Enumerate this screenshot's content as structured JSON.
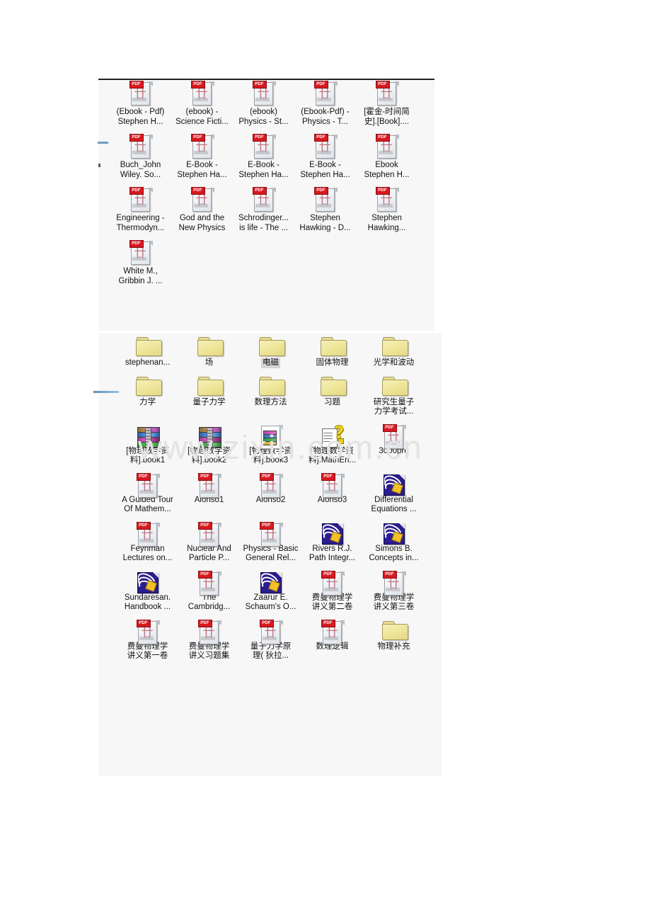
{
  "page": {
    "watermark": "www.zixin.com.cn",
    "background": "#ffffff",
    "panel_bg": "#f7f7f7",
    "selection_bg": "#d4d4d4"
  },
  "panels": [
    {
      "name": "files-panel",
      "kind": "file-list"
    },
    {
      "name": "folders-panel",
      "kind": "folder-and-file-list"
    }
  ],
  "files_panel": {
    "items": [
      {
        "icon": "pdf-icon",
        "label": "(Ebook - Pdf)\nStephen H...",
        "selected": false
      },
      {
        "icon": "pdf-icon",
        "label": "(ebook) -\nScience Ficti...",
        "selected": false
      },
      {
        "icon": "pdf-icon",
        "label": "(ebook)\nPhysics - St...",
        "selected": false
      },
      {
        "icon": "pdf-icon",
        "label": "(Ebook-Pdf) -\nPhysics - T...",
        "selected": false
      },
      {
        "icon": "pdf-icon",
        "label": "[霍金-时间简\n史].[Book]....",
        "selected": false
      },
      {
        "icon": "pdf-icon",
        "label": "Buch_John\nWiley. So...",
        "selected": false
      },
      {
        "icon": "pdf-icon",
        "label": "E-Book -\nStephen Ha...",
        "selected": false
      },
      {
        "icon": "pdf-icon",
        "label": "E-Book -\nStephen Ha...",
        "selected": false
      },
      {
        "icon": "pdf-icon",
        "label": "E-Book -\nStephen Ha...",
        "selected": false
      },
      {
        "icon": "pdf-icon",
        "label": "Ebook\nStephen H...",
        "selected": false
      },
      {
        "icon": "pdf-icon",
        "label": "Engineering -\nThermodyn...",
        "selected": false
      },
      {
        "icon": "pdf-icon",
        "label": "God and the\nNew Physics",
        "selected": false
      },
      {
        "icon": "pdf-icon",
        "label": "Schrodinger...\nis life - The ...",
        "selected": false
      },
      {
        "icon": "pdf-icon",
        "label": "Stephen\nHawking - D...",
        "selected": false
      },
      {
        "icon": "pdf-icon",
        "label": "Stephen\nHawking...",
        "selected": false
      },
      {
        "icon": "pdf-icon",
        "label": "White M.,\nGribbin J. ...",
        "selected": false
      }
    ]
  },
  "folders_panel": {
    "items": [
      {
        "icon": "folder-icon",
        "label": "stephenan...",
        "selected": false
      },
      {
        "icon": "folder-icon",
        "label": "场",
        "selected": false
      },
      {
        "icon": "folder-icon",
        "label": "电磁",
        "selected": true
      },
      {
        "icon": "folder-icon",
        "label": "固体物理",
        "selected": false
      },
      {
        "icon": "folder-icon",
        "label": "光学和波动",
        "selected": false
      },
      {
        "icon": "folder-icon",
        "label": "力学",
        "selected": false
      },
      {
        "icon": "folder-icon",
        "label": "量子力学",
        "selected": false
      },
      {
        "icon": "folder-icon",
        "label": "数理方法",
        "selected": false
      },
      {
        "icon": "folder-icon",
        "label": "习题",
        "selected": false
      },
      {
        "icon": "folder-icon",
        "label": "研究生量子\n力学考试...",
        "selected": false
      },
      {
        "icon": "rar-icon",
        "label": "[物理数学资\n料].book1",
        "selected": false
      },
      {
        "icon": "rar-icon",
        "label": "[物理数学资\n料].book2",
        "selected": false
      },
      {
        "icon": "book3-icon",
        "label": "[物理数学资\n料].book3",
        "selected": false
      },
      {
        "icon": "help-icon",
        "label": "[物理数学资\n料].MathEn...",
        "selected": false
      },
      {
        "icon": "pdf-icon",
        "label": "3000pro",
        "selected": false
      },
      {
        "icon": "pdf-icon",
        "label": "A Guided Tour\nOf Mathem...",
        "selected": false
      },
      {
        "icon": "pdf-icon",
        "label": "Alonso1",
        "selected": false
      },
      {
        "icon": "pdf-icon",
        "label": "Alonso2",
        "selected": false
      },
      {
        "icon": "pdf-icon",
        "label": "Alonso3",
        "selected": false
      },
      {
        "icon": "djvu-icon",
        "label": "Differential\nEquations ...",
        "selected": false
      },
      {
        "icon": "pdf-icon",
        "label": "Feynman\nLectures on...",
        "selected": false
      },
      {
        "icon": "pdf-icon",
        "label": "Nuclear And\nParticle P...",
        "selected": false
      },
      {
        "icon": "pdf-icon",
        "label": "Physics - Basic\nGeneral Rel...",
        "selected": false
      },
      {
        "icon": "djvu-icon",
        "label": "Rivers R.J.\nPath Integr...",
        "selected": false
      },
      {
        "icon": "djvu-icon",
        "label": "Simons B.\nConcepts in...",
        "selected": false
      },
      {
        "icon": "djvu-icon",
        "label": "Sundaresan.\nHandbook ...",
        "selected": false
      },
      {
        "icon": "pdf-icon",
        "label": "The\nCambridg...",
        "selected": false
      },
      {
        "icon": "djvu-icon",
        "label": "Zaarur E.\nSchaum's O...",
        "selected": false
      },
      {
        "icon": "pdf-icon",
        "label": "费曼物理学\n讲义第二卷",
        "selected": false
      },
      {
        "icon": "pdf-icon",
        "label": "费曼物理学\n讲义第三卷",
        "selected": false
      },
      {
        "icon": "pdf-icon",
        "label": "费曼物理学\n讲义第一卷",
        "selected": false
      },
      {
        "icon": "pdf-icon",
        "label": "费曼物理学\n讲义习题集",
        "selected": false
      },
      {
        "icon": "pdf-icon",
        "label": "量子力学原\n理( 狄拉...",
        "selected": false
      },
      {
        "icon": "pdf-icon",
        "label": "数理逻辑",
        "selected": false
      },
      {
        "icon": "folder-icon",
        "label": "物理补充",
        "selected": false
      }
    ]
  }
}
